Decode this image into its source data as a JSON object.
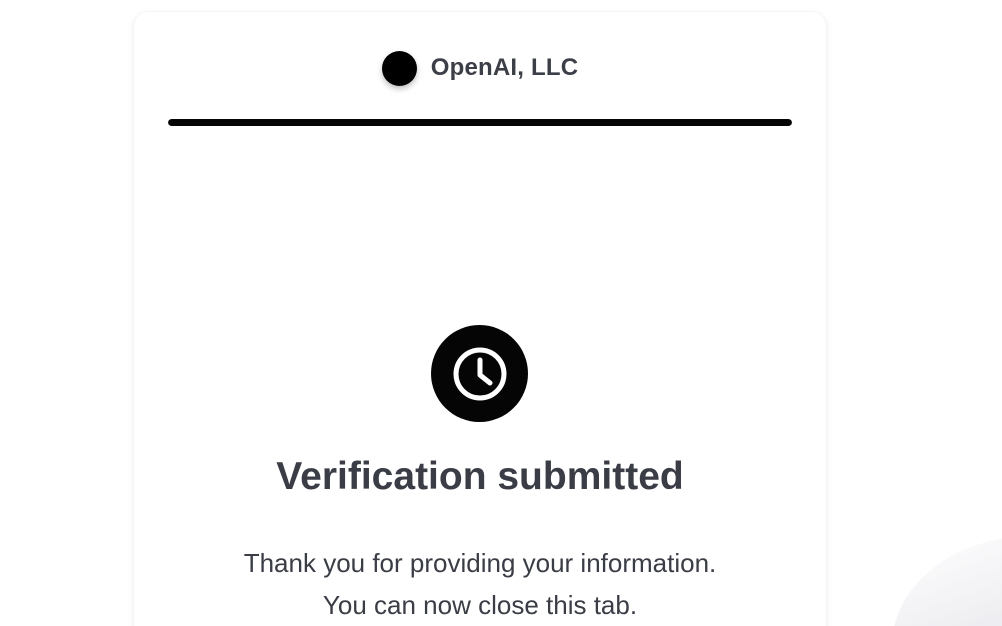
{
  "brand": {
    "name": "OpenAI, LLC"
  },
  "progress": {
    "value": 1.0
  },
  "status": {
    "icon": "clock-icon",
    "title": "Verification submitted",
    "message_line1": "Thank you for providing your information.",
    "message_line2": "You can now close this tab."
  },
  "colors": {
    "accent": "#050505",
    "text": "#3a3d45",
    "card_bg": "#ffffff"
  }
}
